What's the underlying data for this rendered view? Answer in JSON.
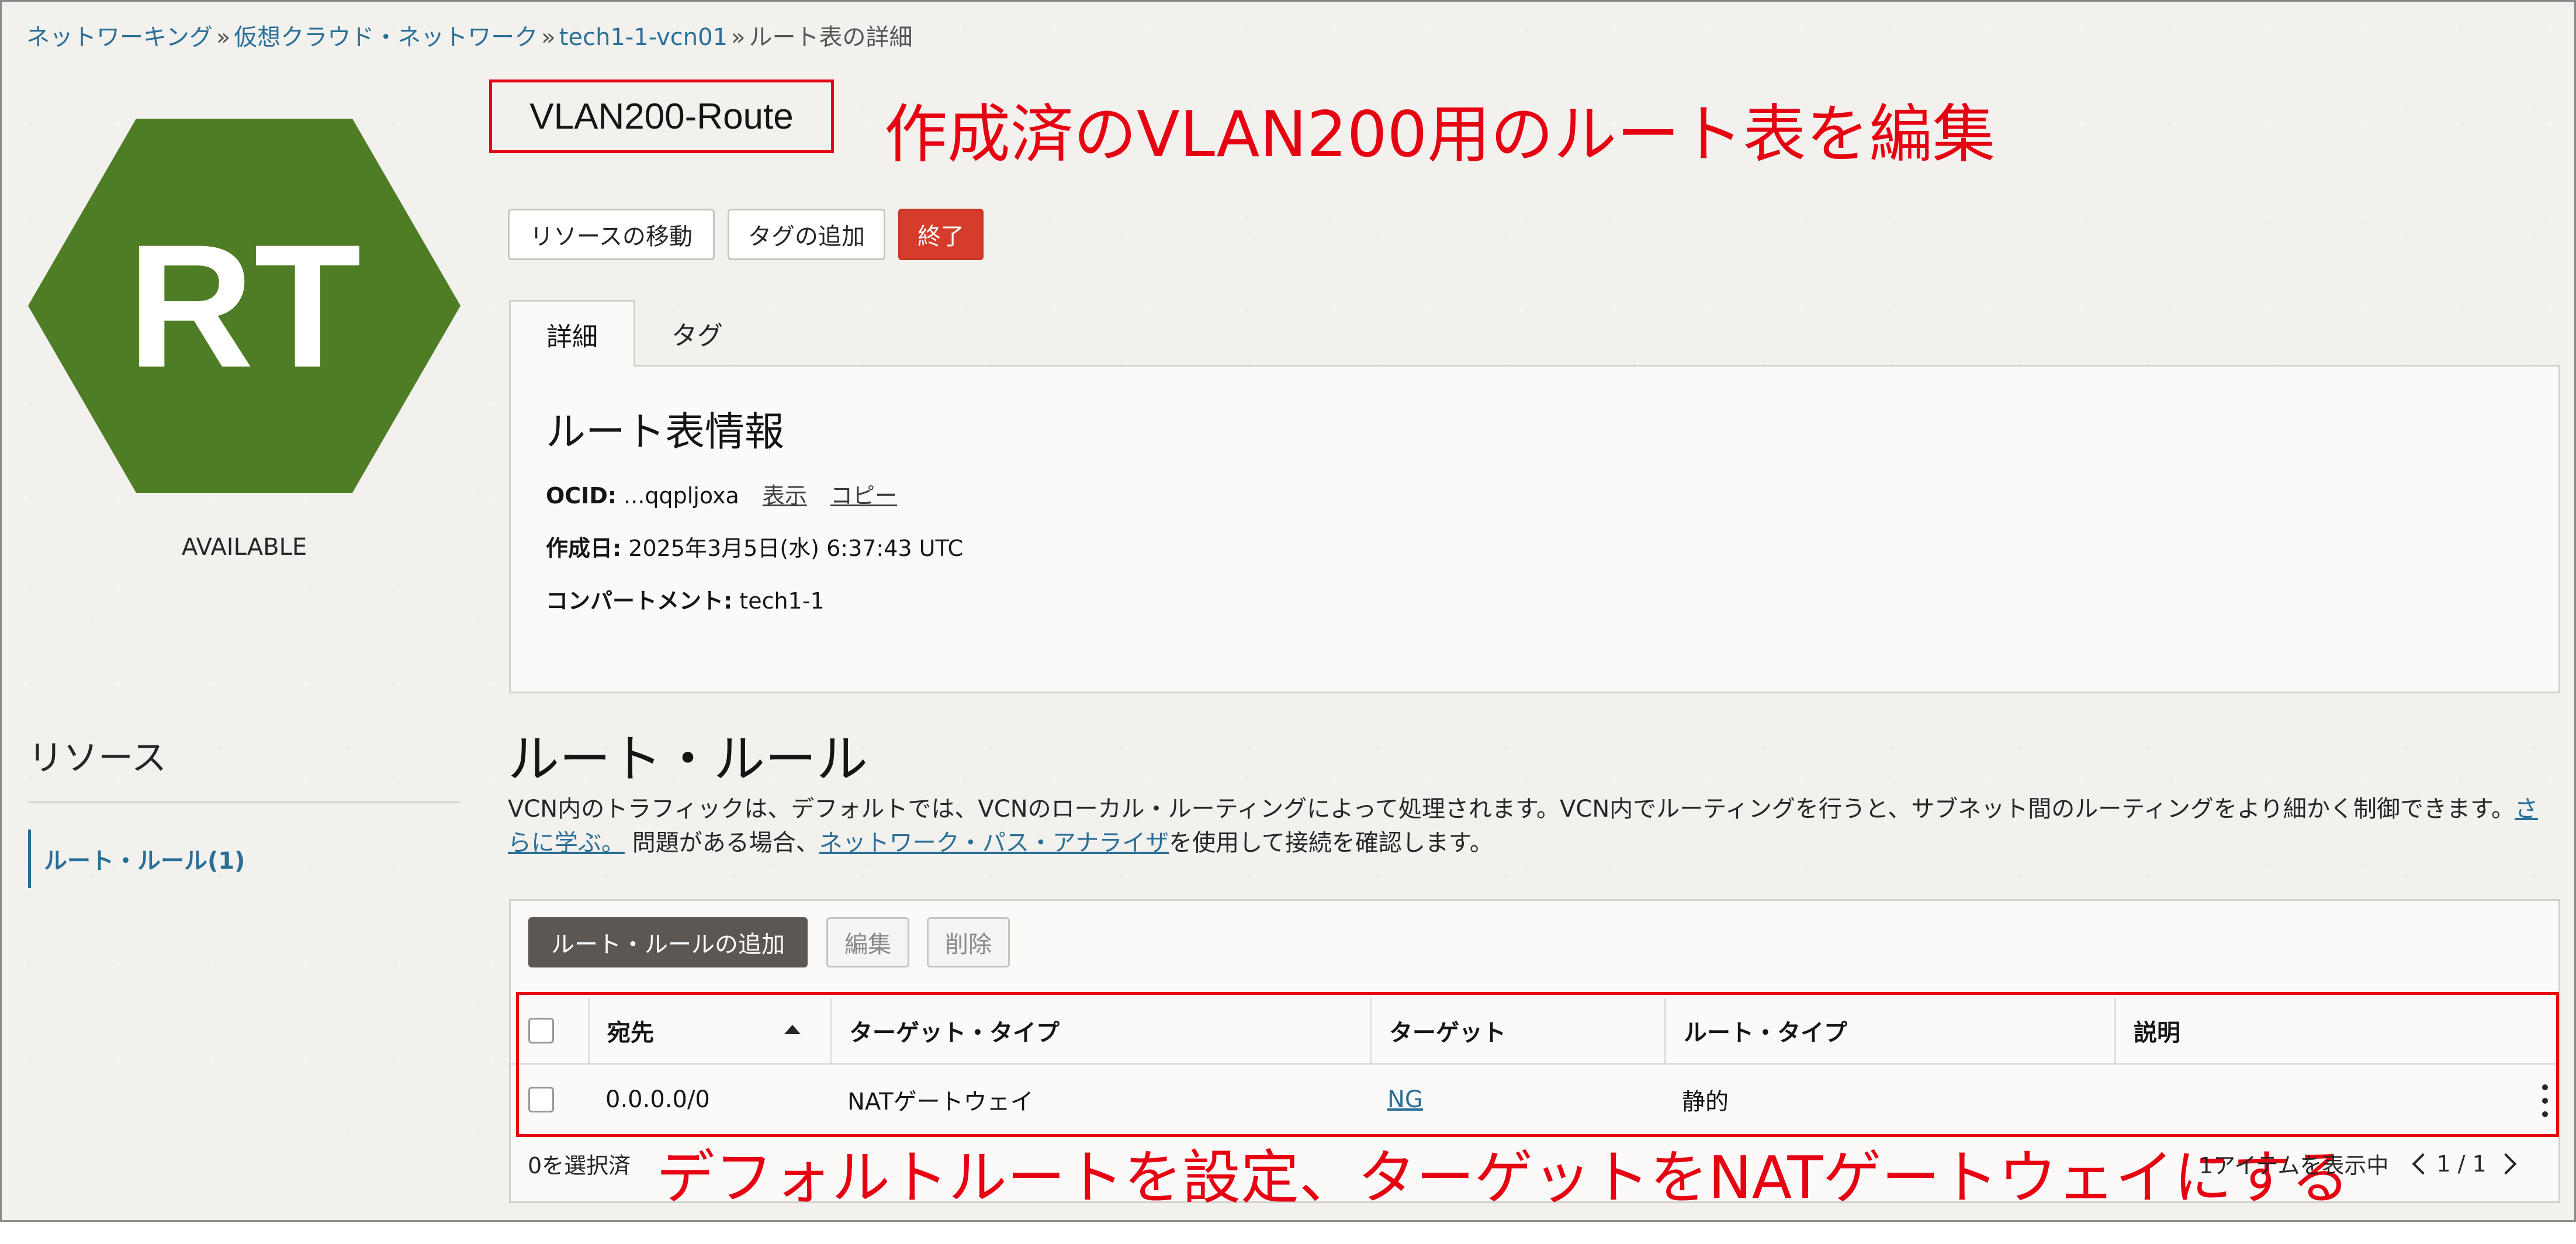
{
  "breadcrumb": {
    "items": [
      "ネットワーキング",
      "仮想クラウド・ネットワーク",
      "tech1-1-vcn01"
    ],
    "separator": "»",
    "current": "ルート表の詳細"
  },
  "resource": {
    "icon_text": "RT",
    "icon_color": "#4f7d25",
    "status": "AVAILABLE",
    "title": "VLAN200-Route"
  },
  "annotations": {
    "top": "作成済のVLAN200用のルート表を編集",
    "bottom": "デフォルトルートを設定、ターゲットをNATゲートウェイにする",
    "color": "#e60012"
  },
  "actions": {
    "move": "リソースの移動",
    "add_tag": "タグの追加",
    "terminate": "終了"
  },
  "tabs": {
    "details": "詳細",
    "tags": "タグ"
  },
  "info": {
    "heading": "ルート表情報",
    "ocid_label": "OCID:",
    "ocid_value": "...qqpljoxa",
    "show": "表示",
    "copy": "コピー",
    "created_label": "作成日:",
    "created_value": "2025年3月5日(水) 6:37:43 UTC",
    "compartment_label": "コンパートメント:",
    "compartment_value": "tech1-1"
  },
  "sidebar": {
    "heading": "リソース",
    "items": [
      {
        "label": "ルート・ルール(1)"
      }
    ]
  },
  "route_rules": {
    "heading": "ルート・ルール",
    "desc_1": "VCN内のトラフィックは、デフォルトでは、VCNのローカル・ルーティングによって処理されます。VCN内でルーティングを行うと、サブネット間のルーティングをより細かく制御できます。",
    "learn_more": "さらに学ぶ。",
    "desc_2": "問題がある場合、",
    "analyzer": "ネットワーク・パス・アナライザ",
    "desc_3": "を使用して接続を確認します。",
    "add_button": "ルート・ルールの追加",
    "edit_button": "編集",
    "delete_button": "削除",
    "columns": [
      "宛先",
      "ターゲット・タイプ",
      "ターゲット",
      "ルート・タイプ",
      "説明"
    ],
    "rows": [
      {
        "destination": "0.0.0.0/0",
        "target_type": "NATゲートウェイ",
        "target": "NG",
        "route_type": "静的",
        "description": ""
      }
    ],
    "selected": "0を選択済",
    "showing": "1アイテムを表示中",
    "page": "1 / 1"
  }
}
